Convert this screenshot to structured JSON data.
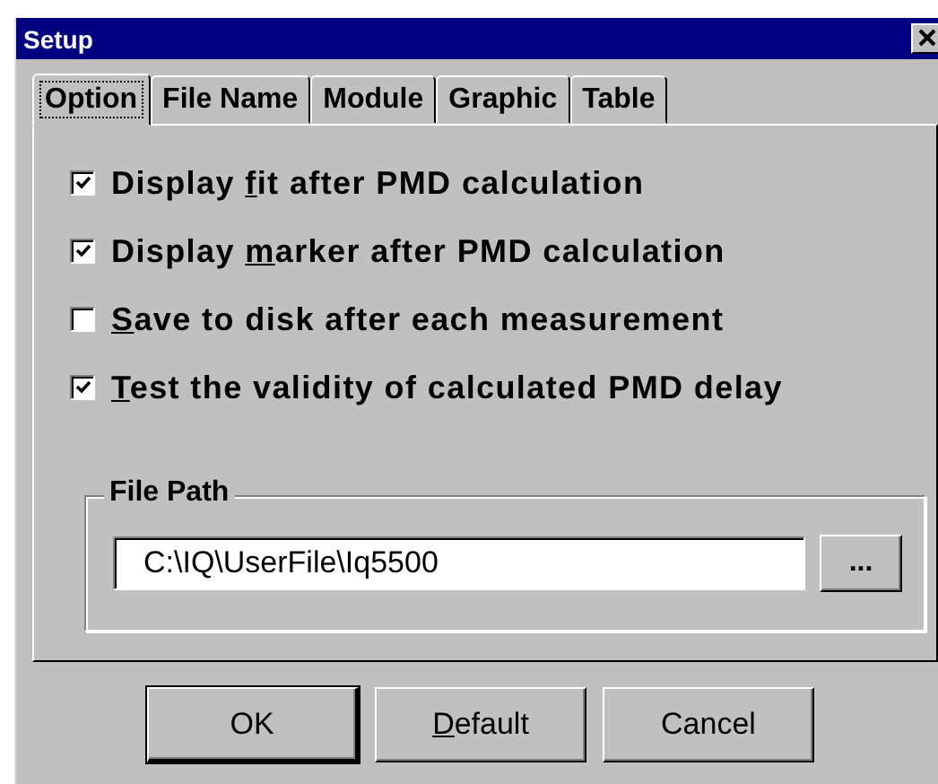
{
  "window": {
    "title": "Setup"
  },
  "tabs": [
    {
      "label": "Option",
      "selected": true
    },
    {
      "label": "File Name",
      "selected": false
    },
    {
      "label": "Module",
      "selected": false
    },
    {
      "label": "Graphic",
      "selected": false
    },
    {
      "label": "Table",
      "selected": false
    }
  ],
  "options": [
    {
      "label": [
        {
          "t": "Display "
        },
        {
          "t": "f",
          "underline": true
        },
        {
          "t": "it after PMD calculation"
        }
      ],
      "checked": true
    },
    {
      "label": [
        {
          "t": "Display "
        },
        {
          "t": "m",
          "underline": true
        },
        {
          "t": "arker after PMD calculation"
        }
      ],
      "checked": true
    },
    {
      "label": [
        {
          "t": "S",
          "underline": true
        },
        {
          "t": "ave to disk after each measurement"
        }
      ],
      "checked": false
    },
    {
      "label": [
        {
          "t": "T",
          "underline": true
        },
        {
          "t": "est the validity of calculated PMD delay"
        }
      ],
      "checked": true
    }
  ],
  "file_path": {
    "label": "File Path",
    "value": "C:\\IQ\\UserFile\\Iq5500",
    "browse_button": "..."
  },
  "buttons": [
    {
      "label": [
        {
          "t": "OK"
        }
      ],
      "default": true
    },
    {
      "label": [
        {
          "t": "D",
          "underline": true
        },
        {
          "t": "efault"
        }
      ],
      "default": false
    },
    {
      "label": [
        {
          "t": "Cancel"
        }
      ],
      "default": false
    }
  ]
}
